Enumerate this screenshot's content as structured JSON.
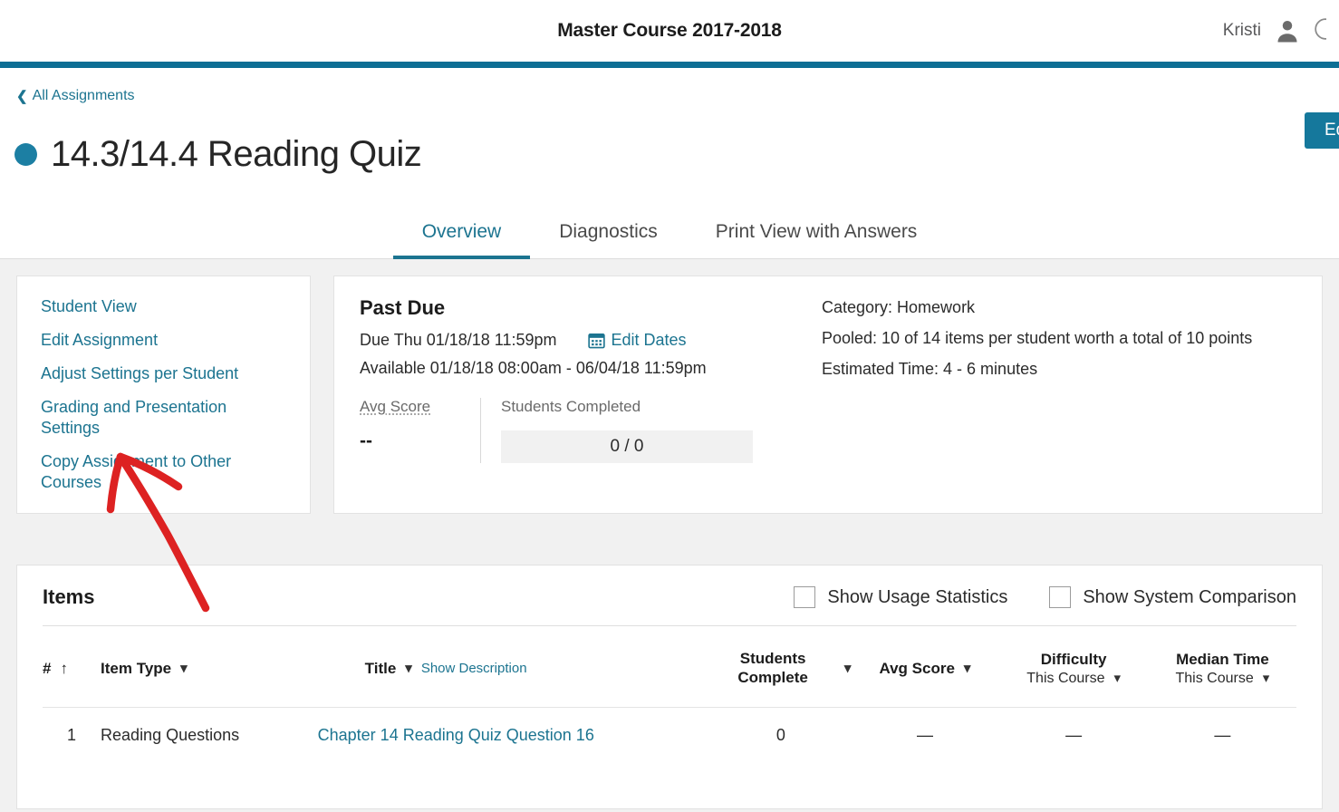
{
  "topbar": {
    "course_title": "Master Course 2017-2018",
    "user_name": "Kristi",
    "avatar_icon": "user-avatar-icon"
  },
  "header": {
    "breadcrumb_label": "All Assignments",
    "breadcrumb_icon": "chevron-left-icon",
    "status_dot_color": "#1c7fa3",
    "title": "14.3/14.4 Reading Quiz",
    "edit_button_label": "Edit",
    "accent_color": "#1c7490",
    "rule_color": "#0d6e94"
  },
  "tabs": [
    {
      "label": "Overview",
      "active": true
    },
    {
      "label": "Diagnostics",
      "active": false
    },
    {
      "label": "Print View with Answers",
      "active": false
    }
  ],
  "links_panel": {
    "items": [
      {
        "label": "Student View"
      },
      {
        "label": "Edit Assignment"
      },
      {
        "label": "Adjust Settings per Student"
      },
      {
        "label": "Grading and Presentation Settings"
      },
      {
        "label": "Copy Assignment to Other Courses"
      }
    ]
  },
  "info_panel": {
    "status": "Past Due",
    "due_line": "Due Thu 01/18/18 11:59pm",
    "edit_dates_label": "Edit Dates",
    "edit_dates_icon": "calendar-icon",
    "available_line": "Available 01/18/18 08:00am - 06/04/18 11:59pm",
    "avg_score_label": "Avg Score",
    "avg_score_value": "--",
    "students_completed_label": "Students Completed",
    "students_completed_value": "0 / 0",
    "category_line": "Category: Homework",
    "pooled_line": "Pooled: 10 of 14 items per student worth a total of 10 points",
    "estimated_time_line": "Estimated Time: 4 - 6 minutes"
  },
  "items_panel": {
    "title": "Items",
    "toggles": [
      {
        "label": "Show Usage Statistics",
        "checked": false
      },
      {
        "label": "Show System Comparison",
        "checked": false
      }
    ],
    "columns": {
      "num": "#",
      "num_sort_icon": "sort-ascending-arrow-icon",
      "item_type": "Item Type",
      "title": "Title",
      "show_description": "Show Description",
      "students_complete": "Students Complete",
      "avg_score": "Avg Score",
      "difficulty": "Difficulty",
      "difficulty_sub": "This Course",
      "median_time": "Median Time",
      "median_time_sub": "This Course",
      "sort_icon": "sort-updown-icon"
    },
    "rows": [
      {
        "num": "1",
        "item_type": "Reading Questions",
        "title": "Chapter 14 Reading Quiz Question 16",
        "students_complete": "0",
        "avg_score": "—",
        "difficulty": "—",
        "median_time": "—"
      }
    ]
  },
  "annotation": {
    "type": "hand-drawn-arrow",
    "color": "#dd2222",
    "points_to": "Copy Assignment to Other Courses"
  }
}
